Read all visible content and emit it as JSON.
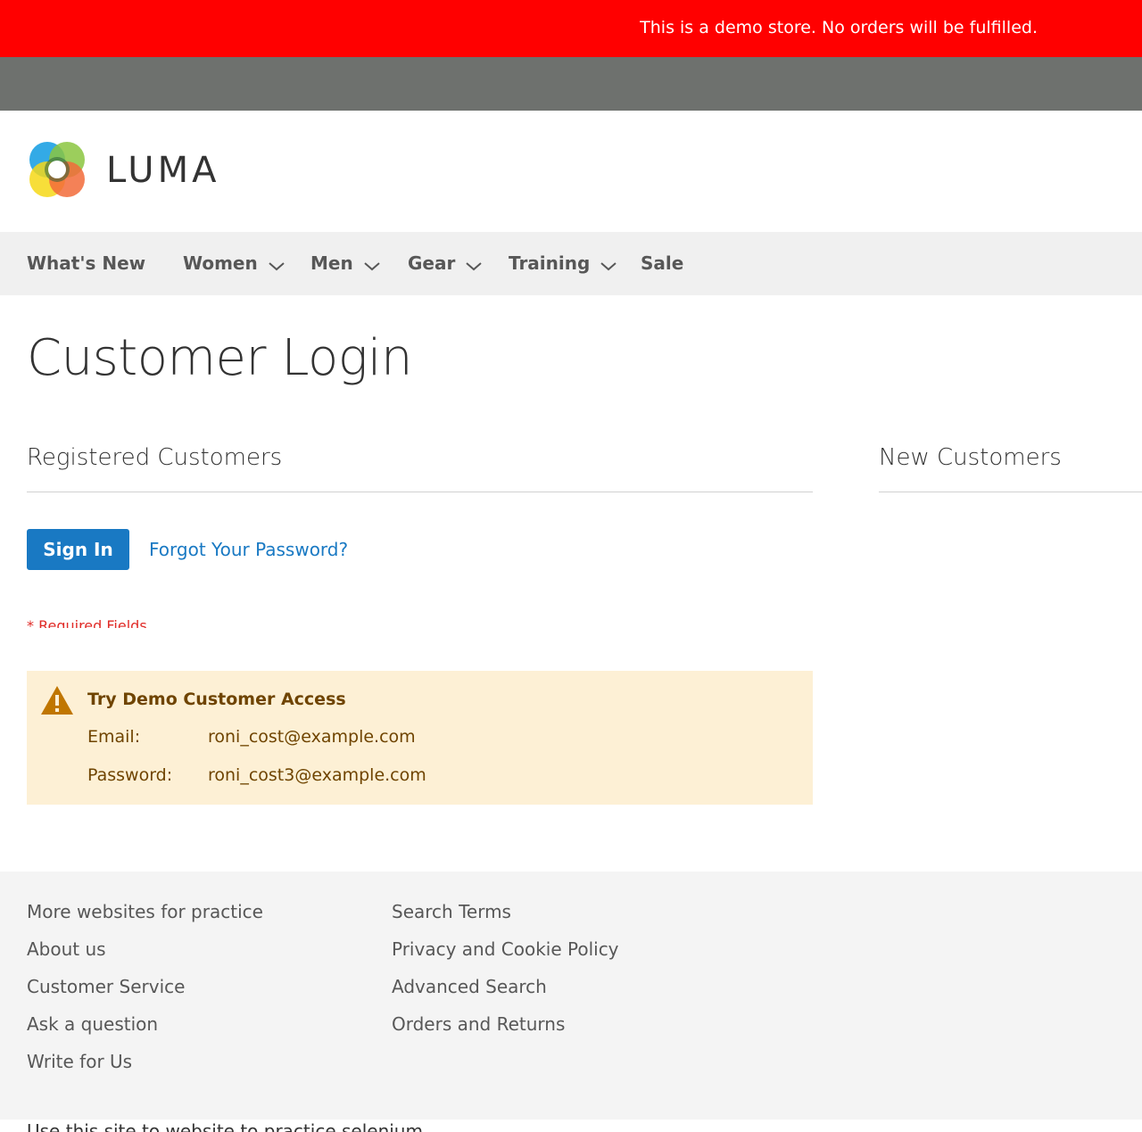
{
  "demo_notice": "This is a demo store. No orders will be fulfilled.",
  "brand": {
    "name": "LUMA",
    "logo_icon": "luma-logo-icon"
  },
  "nav": {
    "items": [
      {
        "label": "What's New",
        "has_dropdown": false
      },
      {
        "label": "Women",
        "has_dropdown": true
      },
      {
        "label": "Men",
        "has_dropdown": true
      },
      {
        "label": "Gear",
        "has_dropdown": true
      },
      {
        "label": "Training",
        "has_dropdown": true
      },
      {
        "label": "Sale",
        "has_dropdown": false
      }
    ]
  },
  "page_title": "Customer Login",
  "registered": {
    "title": "Registered Customers",
    "sign_in_label": "Sign In",
    "forgot_label": "Forgot Your Password?",
    "required_note": "* Required Fields"
  },
  "new_customers": {
    "title": "New Customers"
  },
  "demo_access": {
    "icon": "warning-icon",
    "title": "Try Demo Customer Access",
    "email_label": "Email:",
    "email_value": "roni_cost@example.com",
    "password_label": "Password:",
    "password_value": "roni_cost3@example.com"
  },
  "footer": {
    "col1": [
      "More websites for practice",
      "About us",
      "Customer Service",
      "Ask a question",
      "Write for Us"
    ],
    "col2": [
      "Search Terms",
      "Privacy and Cookie Policy",
      "Advanced Search",
      "Orders and Returns"
    ],
    "copyright": "Use this site to website to practice selenium"
  },
  "colors": {
    "notice_bg": "#ff0000",
    "header_bar": "#6e716e",
    "nav_bg": "#f0f0f0",
    "primary": "#1979c3",
    "required": "#e02b27",
    "demo_bg": "#fdf0d5",
    "demo_text": "#6f4400",
    "footer_bg": "#f4f4f4"
  }
}
